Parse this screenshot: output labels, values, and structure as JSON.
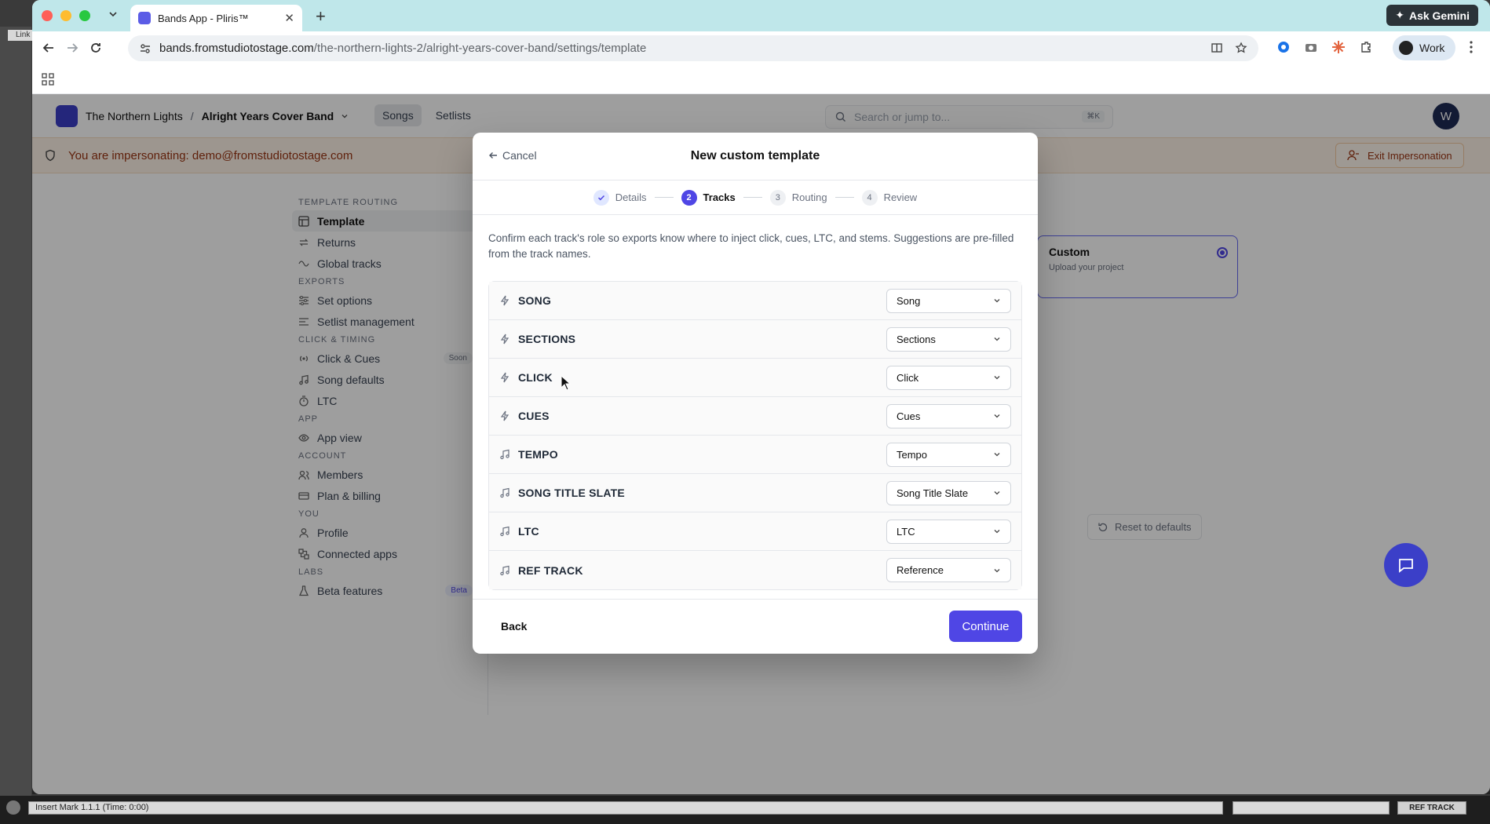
{
  "daw": {
    "link_label": "Link",
    "insert_mark": "Insert Mark 1.1.1 (Time: 0:00)",
    "ref_track_label": "REF TRACK"
  },
  "browser": {
    "tab_title": "Bands App - Pliris™",
    "new_tab": "+",
    "ask_gemini": "Ask Gemini",
    "url_host": "bands.fromstudiotostage.com",
    "url_path": "/the-northern-lights-2/alright-years-cover-band/settings/template",
    "profile_label": "Work"
  },
  "header": {
    "org": "The Northern Lights",
    "separator": "/",
    "band": "Alright Years Cover Band",
    "tabs": [
      {
        "label": "Songs"
      },
      {
        "label": "Setlists"
      }
    ],
    "search_placeholder": "Search or jump to...",
    "search_shortcut": "⌘K",
    "avatar_initial": "W"
  },
  "impersonation": {
    "message": "You are impersonating: demo@fromstudiotostage.com",
    "exit_label": "Exit Impersonation"
  },
  "sidebar": {
    "sections": [
      {
        "title": "TEMPLATE ROUTING",
        "items": [
          {
            "label": "Template",
            "active": true,
            "icon": "template-icon"
          },
          {
            "label": "Returns",
            "icon": "returns-icon"
          },
          {
            "label": "Global tracks",
            "icon": "global-tracks-icon"
          }
        ]
      },
      {
        "title": "EXPORTS",
        "items": [
          {
            "label": "Set options",
            "icon": "sliders-icon"
          },
          {
            "label": "Setlist management",
            "icon": "list-icon"
          }
        ]
      },
      {
        "title": "CLICK & TIMING",
        "items": [
          {
            "label": "Click & Cues",
            "badge": "Soon",
            "icon": "broadcast-icon"
          },
          {
            "label": "Song defaults",
            "icon": "music-note-icon"
          },
          {
            "label": "LTC",
            "icon": "timer-icon"
          }
        ]
      },
      {
        "title": "APP",
        "items": [
          {
            "label": "App view",
            "icon": "eye-icon"
          }
        ]
      },
      {
        "title": "ACCOUNT",
        "items": [
          {
            "label": "Members",
            "icon": "users-icon"
          },
          {
            "label": "Plan & billing",
            "icon": "credit-card-icon"
          }
        ]
      },
      {
        "title": "YOU",
        "items": [
          {
            "label": "Profile",
            "icon": "user-icon"
          },
          {
            "label": "Connected apps",
            "icon": "apps-icon"
          }
        ]
      },
      {
        "title": "LABS",
        "items": [
          {
            "label": "Beta features",
            "badge": "Beta",
            "icon": "flask-icon"
          }
        ]
      }
    ]
  },
  "background": {
    "custom_card_title": "Custom",
    "custom_card_subtitle": "Upload your project",
    "reset_label": "Reset to defaults"
  },
  "modal": {
    "cancel_label": "Cancel",
    "title": "New custom template",
    "steps": [
      {
        "number": "✓",
        "label": "Details",
        "state": "done"
      },
      {
        "number": "2",
        "label": "Tracks",
        "state": "current"
      },
      {
        "number": "3",
        "label": "Routing",
        "state": "upcoming"
      },
      {
        "number": "4",
        "label": "Review",
        "state": "upcoming"
      }
    ],
    "description": "Confirm each track's role so exports know where to inject click, cues, LTC, and stems. Suggestions are pre-filled from the track names.",
    "tracks": [
      {
        "name": "SONG",
        "role": "Song",
        "icon": "bolt-icon"
      },
      {
        "name": "SECTIONS",
        "role": "Sections",
        "icon": "bolt-icon"
      },
      {
        "name": "CLICK",
        "role": "Click",
        "icon": "bolt-icon"
      },
      {
        "name": "CUES",
        "role": "Cues",
        "icon": "bolt-icon"
      },
      {
        "name": "TEMPO",
        "role": "Tempo",
        "icon": "music-note-icon"
      },
      {
        "name": "SONG TITLE SLATE",
        "role": "Song Title Slate",
        "icon": "music-note-icon"
      },
      {
        "name": "LTC",
        "role": "LTC",
        "icon": "music-note-icon"
      },
      {
        "name": "REF TRACK",
        "role": "Reference",
        "icon": "music-note-icon"
      }
    ],
    "back_label": "Back",
    "continue_label": "Continue"
  },
  "colors": {
    "accent": "#4f46e5",
    "impersonation_bg": "#fdf3e7",
    "impersonation_text": "#9a3412",
    "tabbar": "#bfe7ea"
  }
}
